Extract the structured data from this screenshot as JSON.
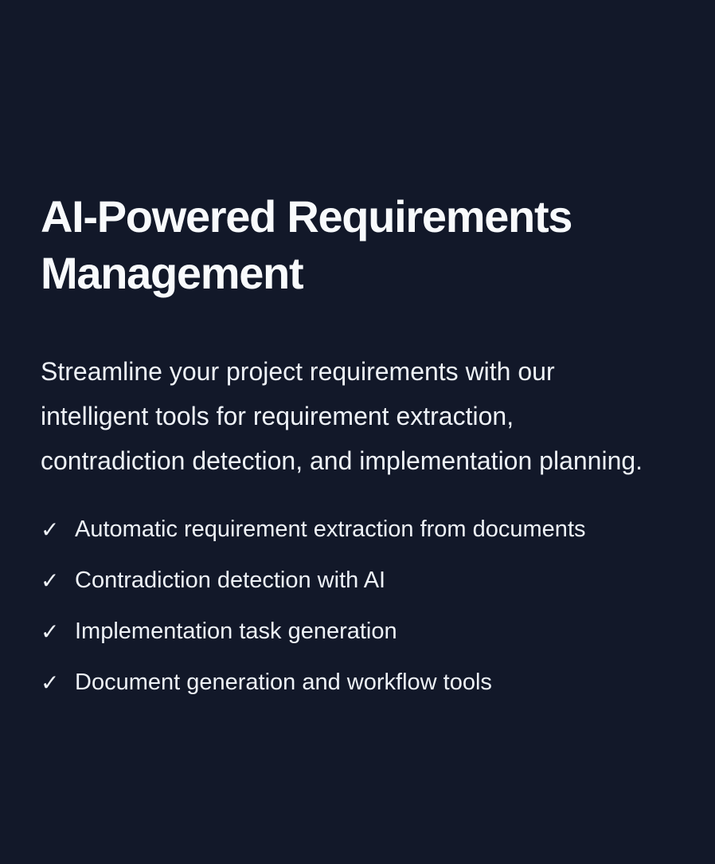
{
  "hero": {
    "title": "AI-Powered Requirements Management",
    "description": "Streamline your project requirements with our intelligent tools for requirement extraction, contradiction detection, and implementation planning.",
    "check_icon": "✓",
    "features": [
      "Automatic requirement extraction from documents",
      "Contradiction detection with AI",
      "Implementation task generation",
      "Document generation and workflow tools"
    ]
  },
  "colors": {
    "background": "#121829",
    "text": "#f8fafc"
  }
}
